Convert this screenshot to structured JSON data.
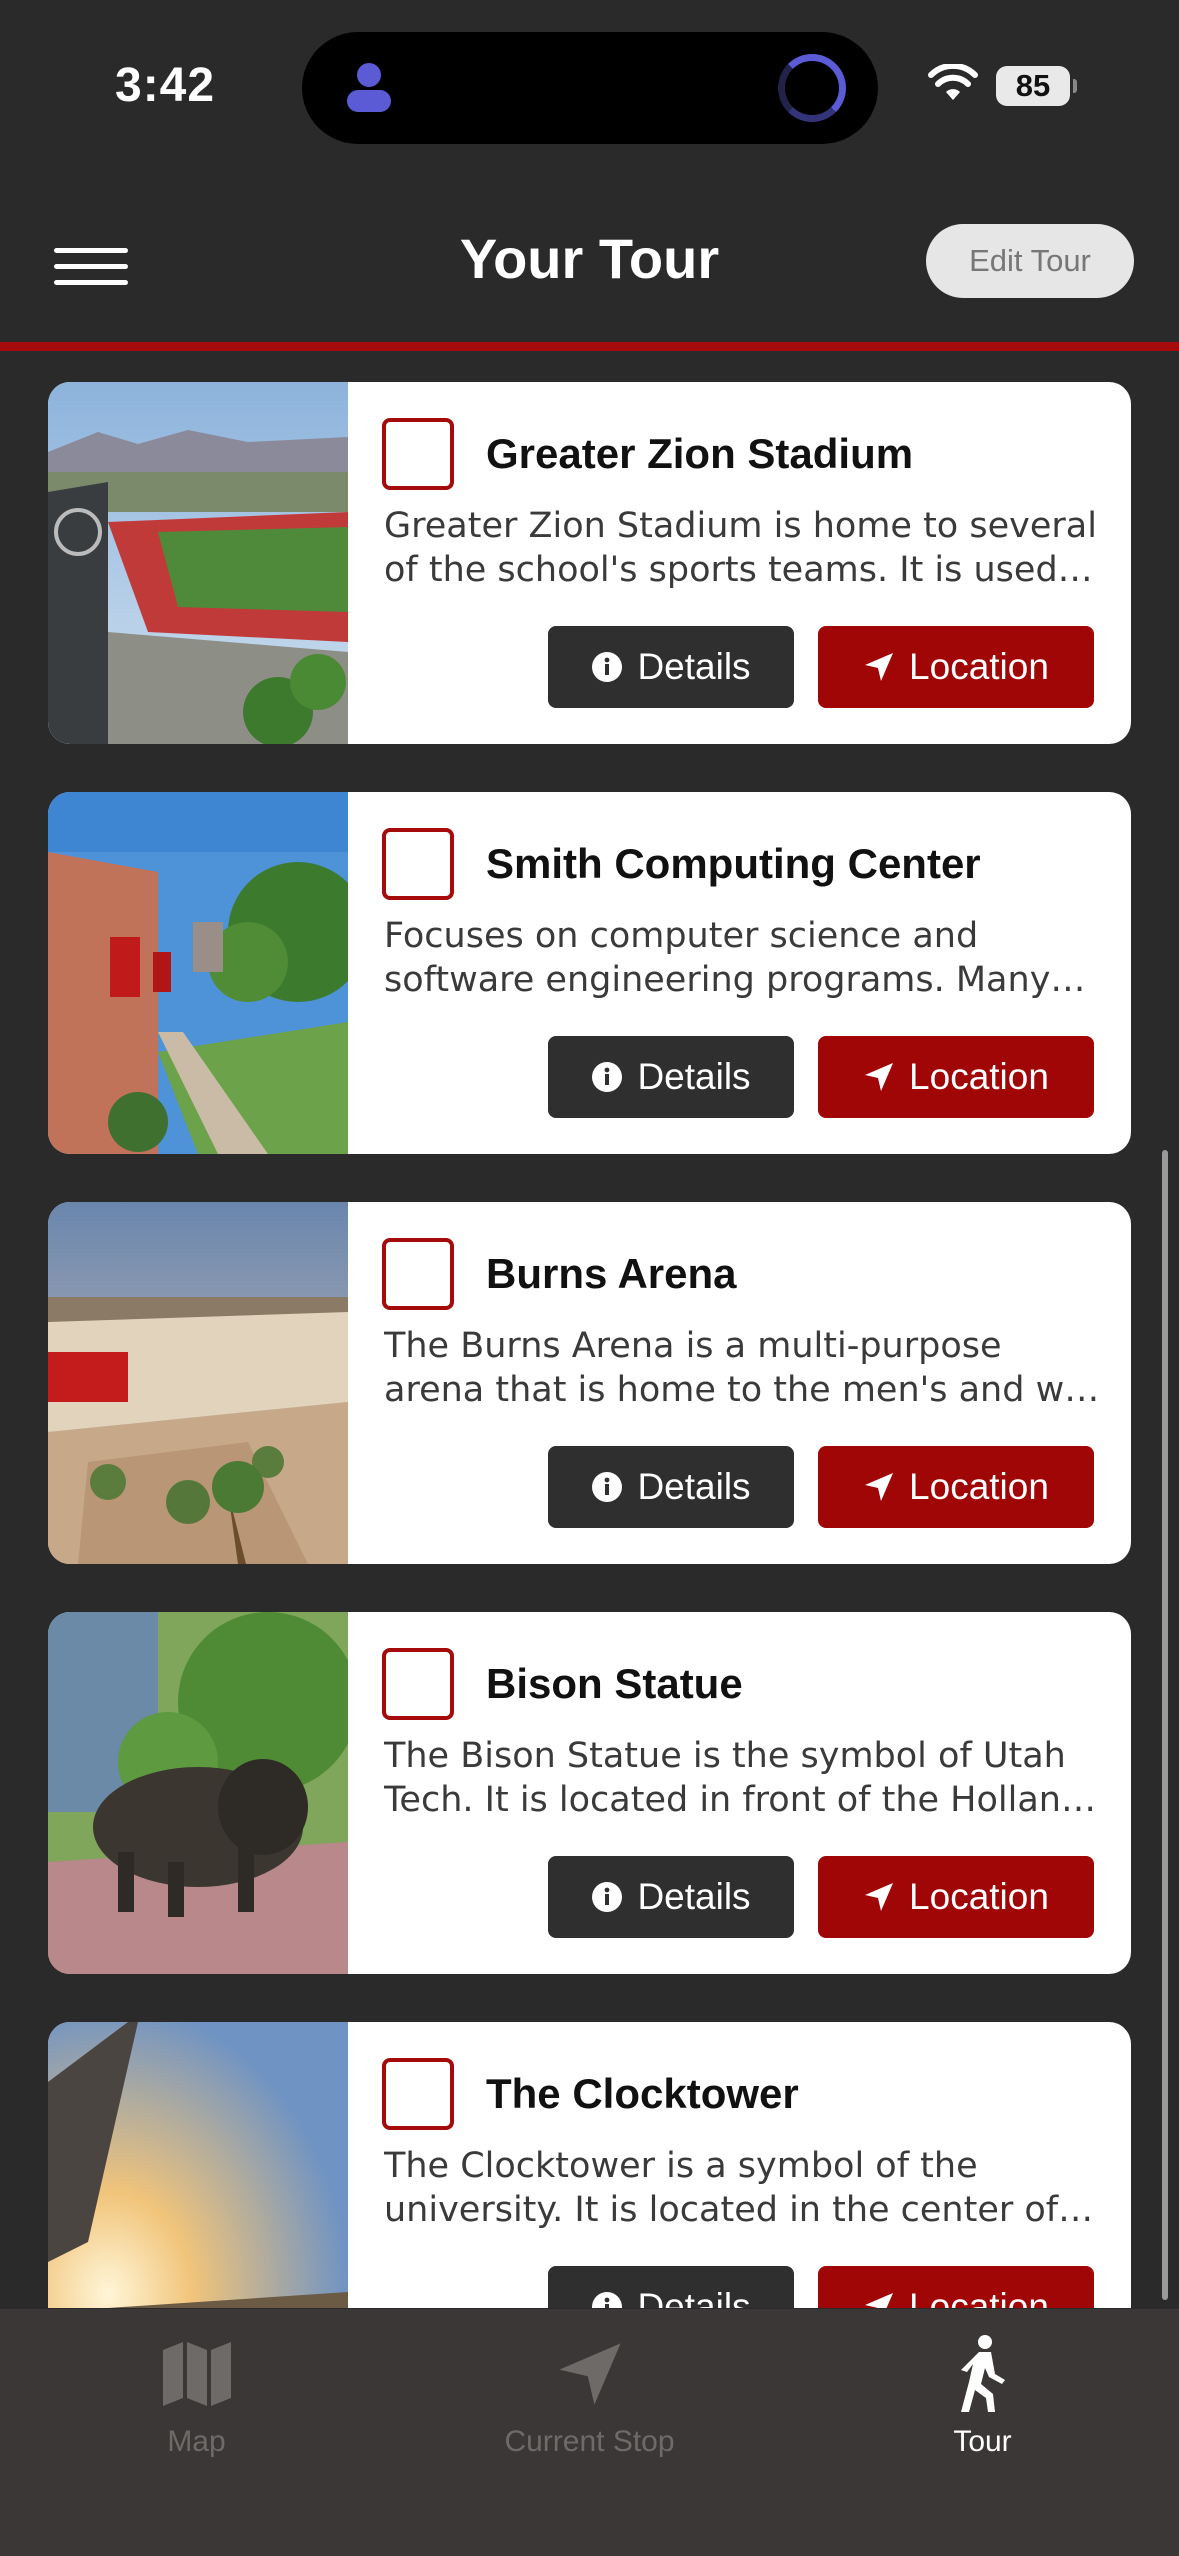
{
  "status_bar": {
    "time": "3:42",
    "battery": "85"
  },
  "header": {
    "title": "Your Tour",
    "edit_label": "Edit Tour"
  },
  "colors": {
    "accent": "#a50b0b",
    "background": "#2a2a2a",
    "details_button": "#2f2f2f"
  },
  "buttons": {
    "details": "Details",
    "location": "Location"
  },
  "stops": [
    {
      "title": "Greater Zion Stadium",
      "description": "Greater Zion Stadium is home to several of the school's sports teams. It is used…",
      "checked": false
    },
    {
      "title": "Smith Computing Center",
      "description": "Focuses on computer science and software engineering programs. Many…",
      "checked": false
    },
    {
      "title": "Burns Arena",
      "description": "The Burns Arena is a multi-purpose arena that is home to the men's and w…",
      "checked": false
    },
    {
      "title": "Bison Statue",
      "description": "The Bison Statue is the symbol of Utah Tech. It is located in front of the Hollan…",
      "checked": false
    },
    {
      "title": "The Clocktower",
      "description": "The Clocktower is a symbol of the university. It is located in the center of…",
      "checked": false
    }
  ],
  "tabs": [
    {
      "label": "Map",
      "icon": "map-icon",
      "active": false
    },
    {
      "label": "Current Stop",
      "icon": "navigation-arrow-icon",
      "active": false
    },
    {
      "label": "Tour",
      "icon": "walking-person-icon",
      "active": true
    }
  ]
}
